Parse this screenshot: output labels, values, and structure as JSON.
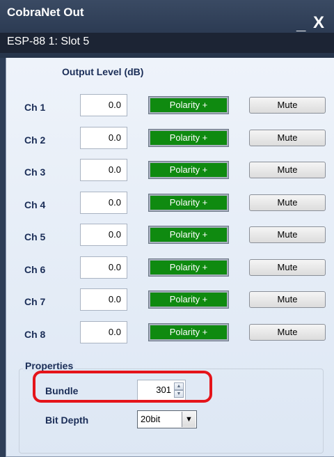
{
  "window": {
    "title": "CobraNet Out",
    "subtitle": "ESP-88 1: Slot 5",
    "minimize_glyph": "_",
    "close_glyph": "X"
  },
  "output": {
    "header": "Output Level (dB)",
    "channels": [
      {
        "label": "Ch 1",
        "level": "0.0",
        "polarity": "Polarity +",
        "mute": "Mute"
      },
      {
        "label": "Ch 2",
        "level": "0.0",
        "polarity": "Polarity +",
        "mute": "Mute"
      },
      {
        "label": "Ch 3",
        "level": "0.0",
        "polarity": "Polarity +",
        "mute": "Mute"
      },
      {
        "label": "Ch 4",
        "level": "0.0",
        "polarity": "Polarity +",
        "mute": "Mute"
      },
      {
        "label": "Ch 5",
        "level": "0.0",
        "polarity": "Polarity +",
        "mute": "Mute"
      },
      {
        "label": "Ch 6",
        "level": "0.0",
        "polarity": "Polarity +",
        "mute": "Mute"
      },
      {
        "label": "Ch 7",
        "level": "0.0",
        "polarity": "Polarity +",
        "mute": "Mute"
      },
      {
        "label": "Ch 8",
        "level": "0.0",
        "polarity": "Polarity +",
        "mute": "Mute"
      }
    ]
  },
  "properties": {
    "title": "Properties",
    "bundle_label": "Bundle",
    "bundle_value": "301",
    "bit_depth_label": "Bit Depth",
    "bit_depth_value": "20bit"
  },
  "colors": {
    "titlebar": "#2e3e57",
    "polarity_active": "#0f8a10",
    "label_text": "#1a2d57",
    "highlight": "#e5141a"
  }
}
